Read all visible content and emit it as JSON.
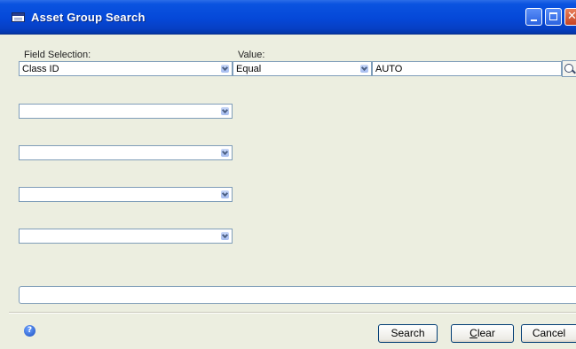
{
  "window": {
    "title": "Asset Group Search",
    "icon": "window-app-icon"
  },
  "labels": {
    "field_selection": "Field Selection:",
    "value": "Value:"
  },
  "rows": [
    {
      "field": "Class ID",
      "operator": "Equal",
      "value": "AUTO"
    },
    {
      "field": ""
    },
    {
      "field": ""
    },
    {
      "field": ""
    },
    {
      "field": ""
    }
  ],
  "status": {
    "text": ""
  },
  "buttons": {
    "search": "Search",
    "clear_prefix": "",
    "clear_underline": "C",
    "clear_rest": "lear",
    "cancel": "Cancel"
  },
  "icons": {
    "help": "help-icon",
    "lookup": "magnifier-icon",
    "dropdown": "chevron-down-icon"
  },
  "colors": {
    "titlebar": "#0548d8",
    "window_bg": "#eceee0",
    "field_border": "#7f9db9"
  }
}
